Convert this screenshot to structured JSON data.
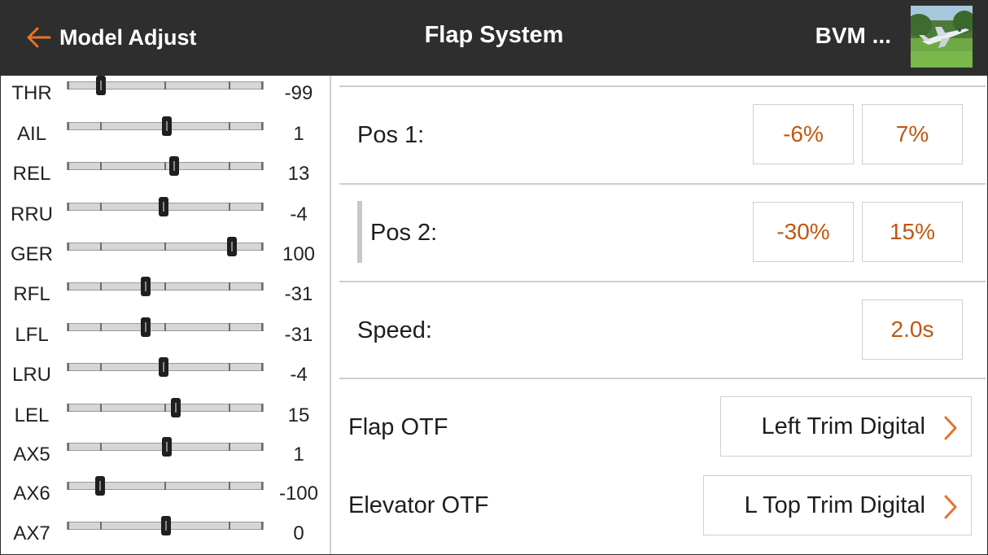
{
  "header": {
    "back_label": "Model Adjust",
    "title": "Flap System",
    "model_name": "BVM ...",
    "accent_color": "#E8732A",
    "background_color": "#2E2E2E"
  },
  "monitor": {
    "channels": [
      {
        "name": "THR",
        "value": "-99"
      },
      {
        "name": "AIL",
        "value": "1"
      },
      {
        "name": "REL",
        "value": "13"
      },
      {
        "name": "RRU",
        "value": "-4"
      },
      {
        "name": "GER",
        "value": "100"
      },
      {
        "name": "RFL",
        "value": "-31"
      },
      {
        "name": "LFL",
        "value": "-31"
      },
      {
        "name": "LRU",
        "value": "-4"
      },
      {
        "name": "LEL",
        "value": "15"
      },
      {
        "name": "AX5",
        "value": "1"
      },
      {
        "name": "AX6",
        "value": "-100"
      },
      {
        "name": "AX7",
        "value": "0"
      }
    ]
  },
  "flap": {
    "pos1": {
      "label": "Pos 1:",
      "flap": "-6%",
      "elevator": "7%"
    },
    "pos2": {
      "label": "Pos 2:",
      "flap": "-30%",
      "elevator": "15%"
    },
    "speed": {
      "label": "Speed:",
      "value": "2.0s"
    },
    "flap_otf": {
      "label": "Flap OTF",
      "value": "Left Trim Digital"
    },
    "elevator_otf": {
      "label": "Elevator OTF",
      "value": "L Top Trim Digital"
    },
    "value_color": "#C0570F"
  }
}
